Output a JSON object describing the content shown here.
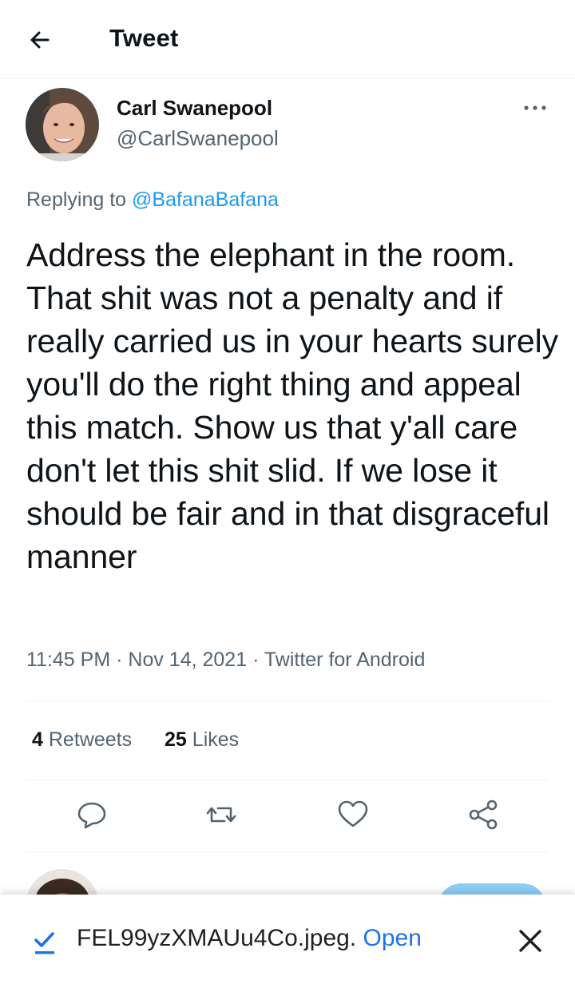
{
  "header": {
    "title": "Tweet"
  },
  "tweet": {
    "author": {
      "display_name": "Carl Swanepool",
      "handle": "@CarlSwanepool"
    },
    "replying_prefix": "Replying to",
    "replying_to": "@BafanaBafana",
    "text": "Address the elephant in the room. That shit was not a penalty and if really carried us in your hearts surely you'll do the right thing and appeal this match. Show us that y'all care don't let this shit slid. If we lose it should be fair and in that disgraceful manner",
    "meta": {
      "time": "11:45 PM",
      "separator": "·",
      "date": "Nov 14, 2021",
      "source": "Twitter for Android"
    },
    "stats": {
      "retweets_count": "4",
      "retweets_label": "Retweets",
      "likes_count": "25",
      "likes_label": "Likes"
    },
    "actions": [
      "reply-icon",
      "retweet-icon",
      "like-icon",
      "share-icon"
    ]
  },
  "download_bar": {
    "filename": "FEL99yzXMAUu4Co.jpeg.",
    "open_label": "Open"
  },
  "colors": {
    "link": "#1d9bf0",
    "secondary_text": "#536471",
    "download_link": "#1a73e8"
  }
}
